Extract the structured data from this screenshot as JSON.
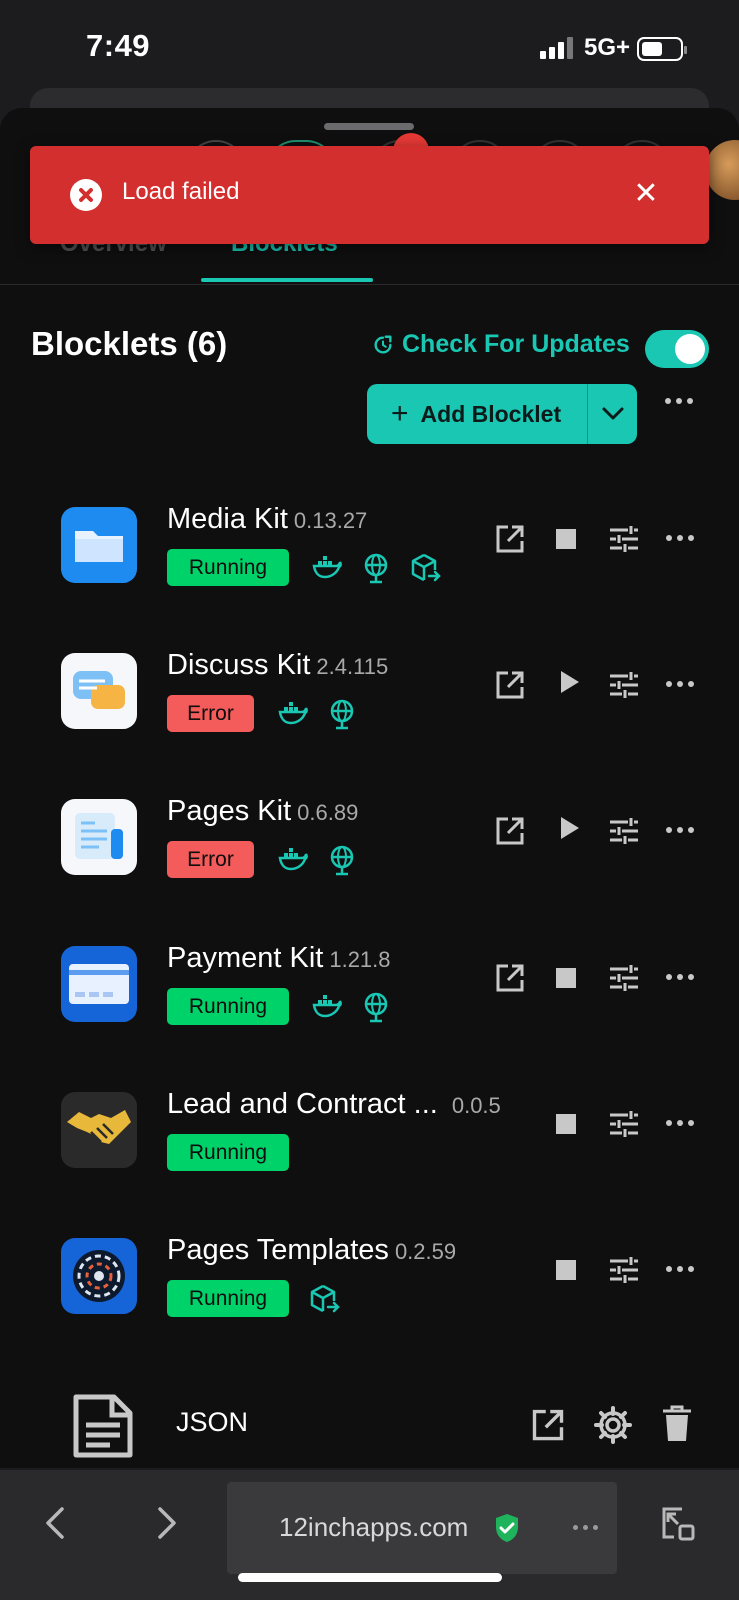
{
  "status_bar": {
    "time": "7:49",
    "network": "5G+"
  },
  "toast": {
    "message": "Load failed"
  },
  "tabs": [
    {
      "label": "Overview"
    },
    {
      "label": "Blocklets"
    }
  ],
  "section": {
    "title": "Blocklets (6)",
    "check_updates": "Check For Updates",
    "add_label": "Add Blocklet"
  },
  "blocklets": [
    {
      "name": "Media Kit",
      "version": "0.13.27",
      "status": "Running"
    },
    {
      "name": "Discuss Kit",
      "version": "2.4.115",
      "status": "Error"
    },
    {
      "name": "Pages Kit",
      "version": "0.6.89",
      "status": "Error"
    },
    {
      "name": "Payment Kit",
      "version": "1.21.8",
      "status": "Running"
    },
    {
      "name": "Lead and Contract ...",
      "version": "0.0.5",
      "status": "Running"
    },
    {
      "name": "Pages Templates",
      "version": "0.2.59",
      "status": "Running"
    }
  ],
  "json_row": {
    "label": "JSON"
  },
  "browser": {
    "url": "12inchapps.com"
  },
  "colors": {
    "accent": "#19c7b3",
    "running": "#00d26a",
    "error": "#f45b5b",
    "toast": "#d32f2f"
  }
}
